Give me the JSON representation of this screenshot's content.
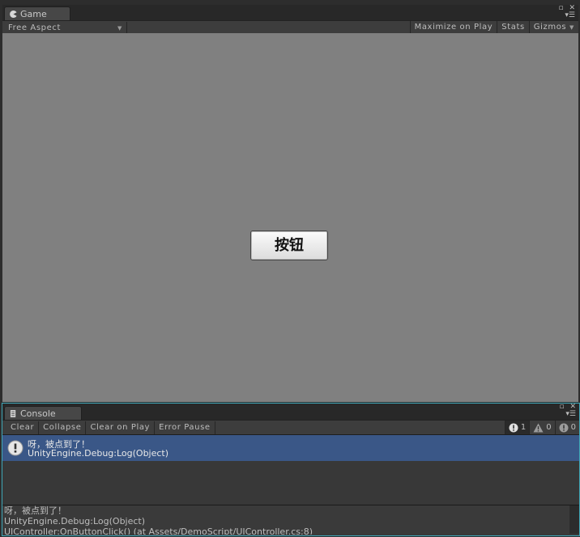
{
  "game": {
    "tab_title": "Game",
    "aspect": "Free Aspect",
    "toolbar": {
      "maximize_on_play": "Maximize on Play",
      "stats": "Stats",
      "gizmos": "Gizmos"
    },
    "button_label": "按钮"
  },
  "console": {
    "tab_title": "Console",
    "toolbar": {
      "clear": "Clear",
      "collapse": "Collapse",
      "clear_on_play": "Clear on Play",
      "error_pause": "Error Pause"
    },
    "counts": {
      "info": "1",
      "warning": "0",
      "error": "0"
    },
    "entries": [
      {
        "line1": "呀，被点到了！",
        "line2": "UnityEngine.Debug:Log(Object)"
      }
    ],
    "detail": [
      "呀，被点到了！",
      "UnityEngine.Debug:Log(Object)",
      "UIController:OnButtonClick() (at Assets/DemoScript/UIController.cs:8)"
    ]
  },
  "colors": {
    "selected_row": "#3a5787",
    "focus_border": "#3fa7b7",
    "game_background": "#808080"
  }
}
